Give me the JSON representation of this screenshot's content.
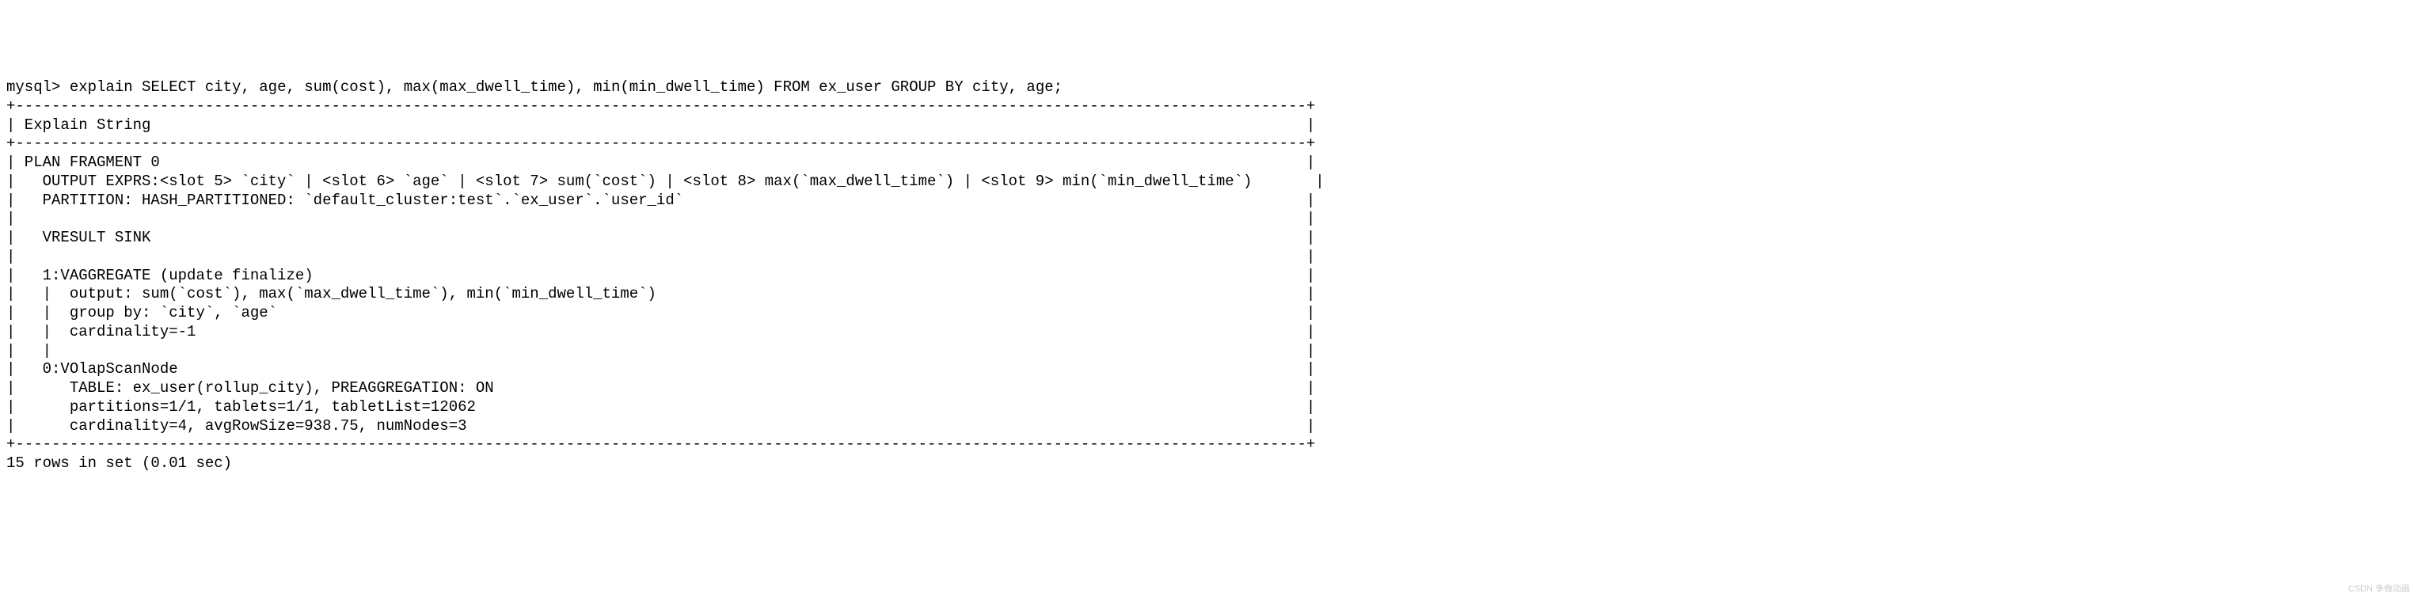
{
  "terminal": {
    "prompt": "mysql> ",
    "query": "explain SELECT city, age, sum(cost), max(max_dwell_time), min(min_dwell_time) FROM ex_user GROUP BY city, age;",
    "separator_top": "+-----------------------------------------------------------------------------------------------------------------------------------------------+",
    "column_header": "| Explain String                                                                                                                                |",
    "separator_mid": "+-----------------------------------------------------------------------------------------------------------------------------------------------+",
    "plan_lines": [
      "| PLAN FRAGMENT 0                                                                                                                               |",
      "|   OUTPUT EXPRS:<slot 5> `city` | <slot 6> `age` | <slot 7> sum(`cost`) | <slot 8> max(`max_dwell_time`) | <slot 9> min(`min_dwell_time`)       |",
      "|   PARTITION: HASH_PARTITIONED: `default_cluster:test`.`ex_user`.`user_id`                                                                     |",
      "|                                                                                                                                               |",
      "|   VRESULT SINK                                                                                                                                |",
      "|                                                                                                                                               |",
      "|   1:VAGGREGATE (update finalize)                                                                                                              |",
      "|   |  output: sum(`cost`), max(`max_dwell_time`), min(`min_dwell_time`)                                                                        |",
      "|   |  group by: `city`, `age`                                                                                                                  |",
      "|   |  cardinality=-1                                                                                                                           |",
      "|   |                                                                                                                                           |",
      "|   0:VOlapScanNode                                                                                                                             |",
      "|      TABLE: ex_user(rollup_city), PREAGGREGATION: ON                                                                                          |",
      "|      partitions=1/1, tablets=1/1, tabletList=12062                                                                                            |",
      "|      cardinality=4, avgRowSize=938.75, numNodes=3                                                                                             |"
    ],
    "separator_bottom": "+-----------------------------------------------------------------------------------------------------------------------------------------------+",
    "result_footer": "15 rows in set (0.01 sec)"
  },
  "watermark": "CSDN 争做动画"
}
